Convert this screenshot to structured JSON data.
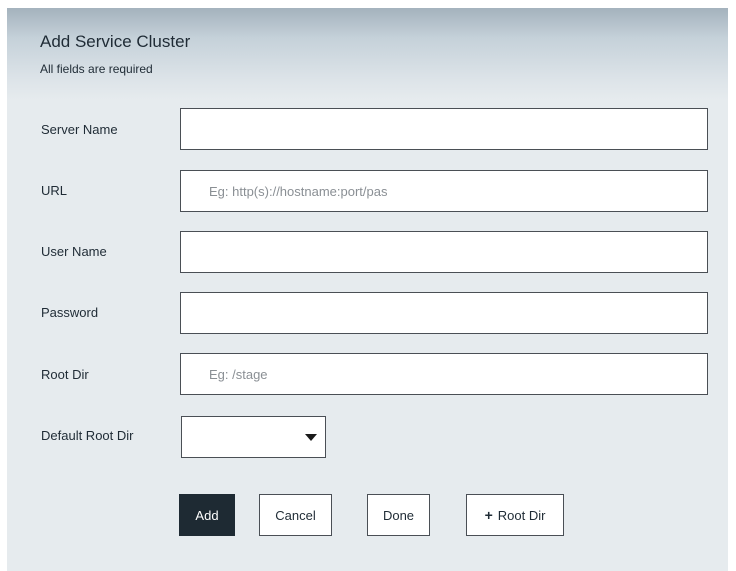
{
  "dialog": {
    "title": "Add Service Cluster",
    "subtitle": "All fields are required"
  },
  "form": {
    "server_name": {
      "label": "Server Name",
      "value": "",
      "placeholder": ""
    },
    "url": {
      "label": "URL",
      "value": "",
      "placeholder": "Eg: http(s)://hostname:port/pas"
    },
    "user_name": {
      "label": "User Name",
      "value": "",
      "placeholder": ""
    },
    "password": {
      "label": "Password",
      "value": "",
      "placeholder": ""
    },
    "root_dir": {
      "label": "Root Dir",
      "value": "",
      "placeholder": "Eg: /stage"
    },
    "default_root_dir": {
      "label": "Default Root Dir",
      "selected": ""
    }
  },
  "buttons": {
    "add": "Add",
    "cancel": "Cancel",
    "done": "Done",
    "root_dir_plus": "+",
    "root_dir": "Root Dir"
  },
  "icons": {
    "dropdown": "caret-down-icon",
    "add_root_dir": "plus-icon"
  },
  "colors": {
    "primary_button": "#1e2a33",
    "dialog_background": "#e6ebee"
  }
}
